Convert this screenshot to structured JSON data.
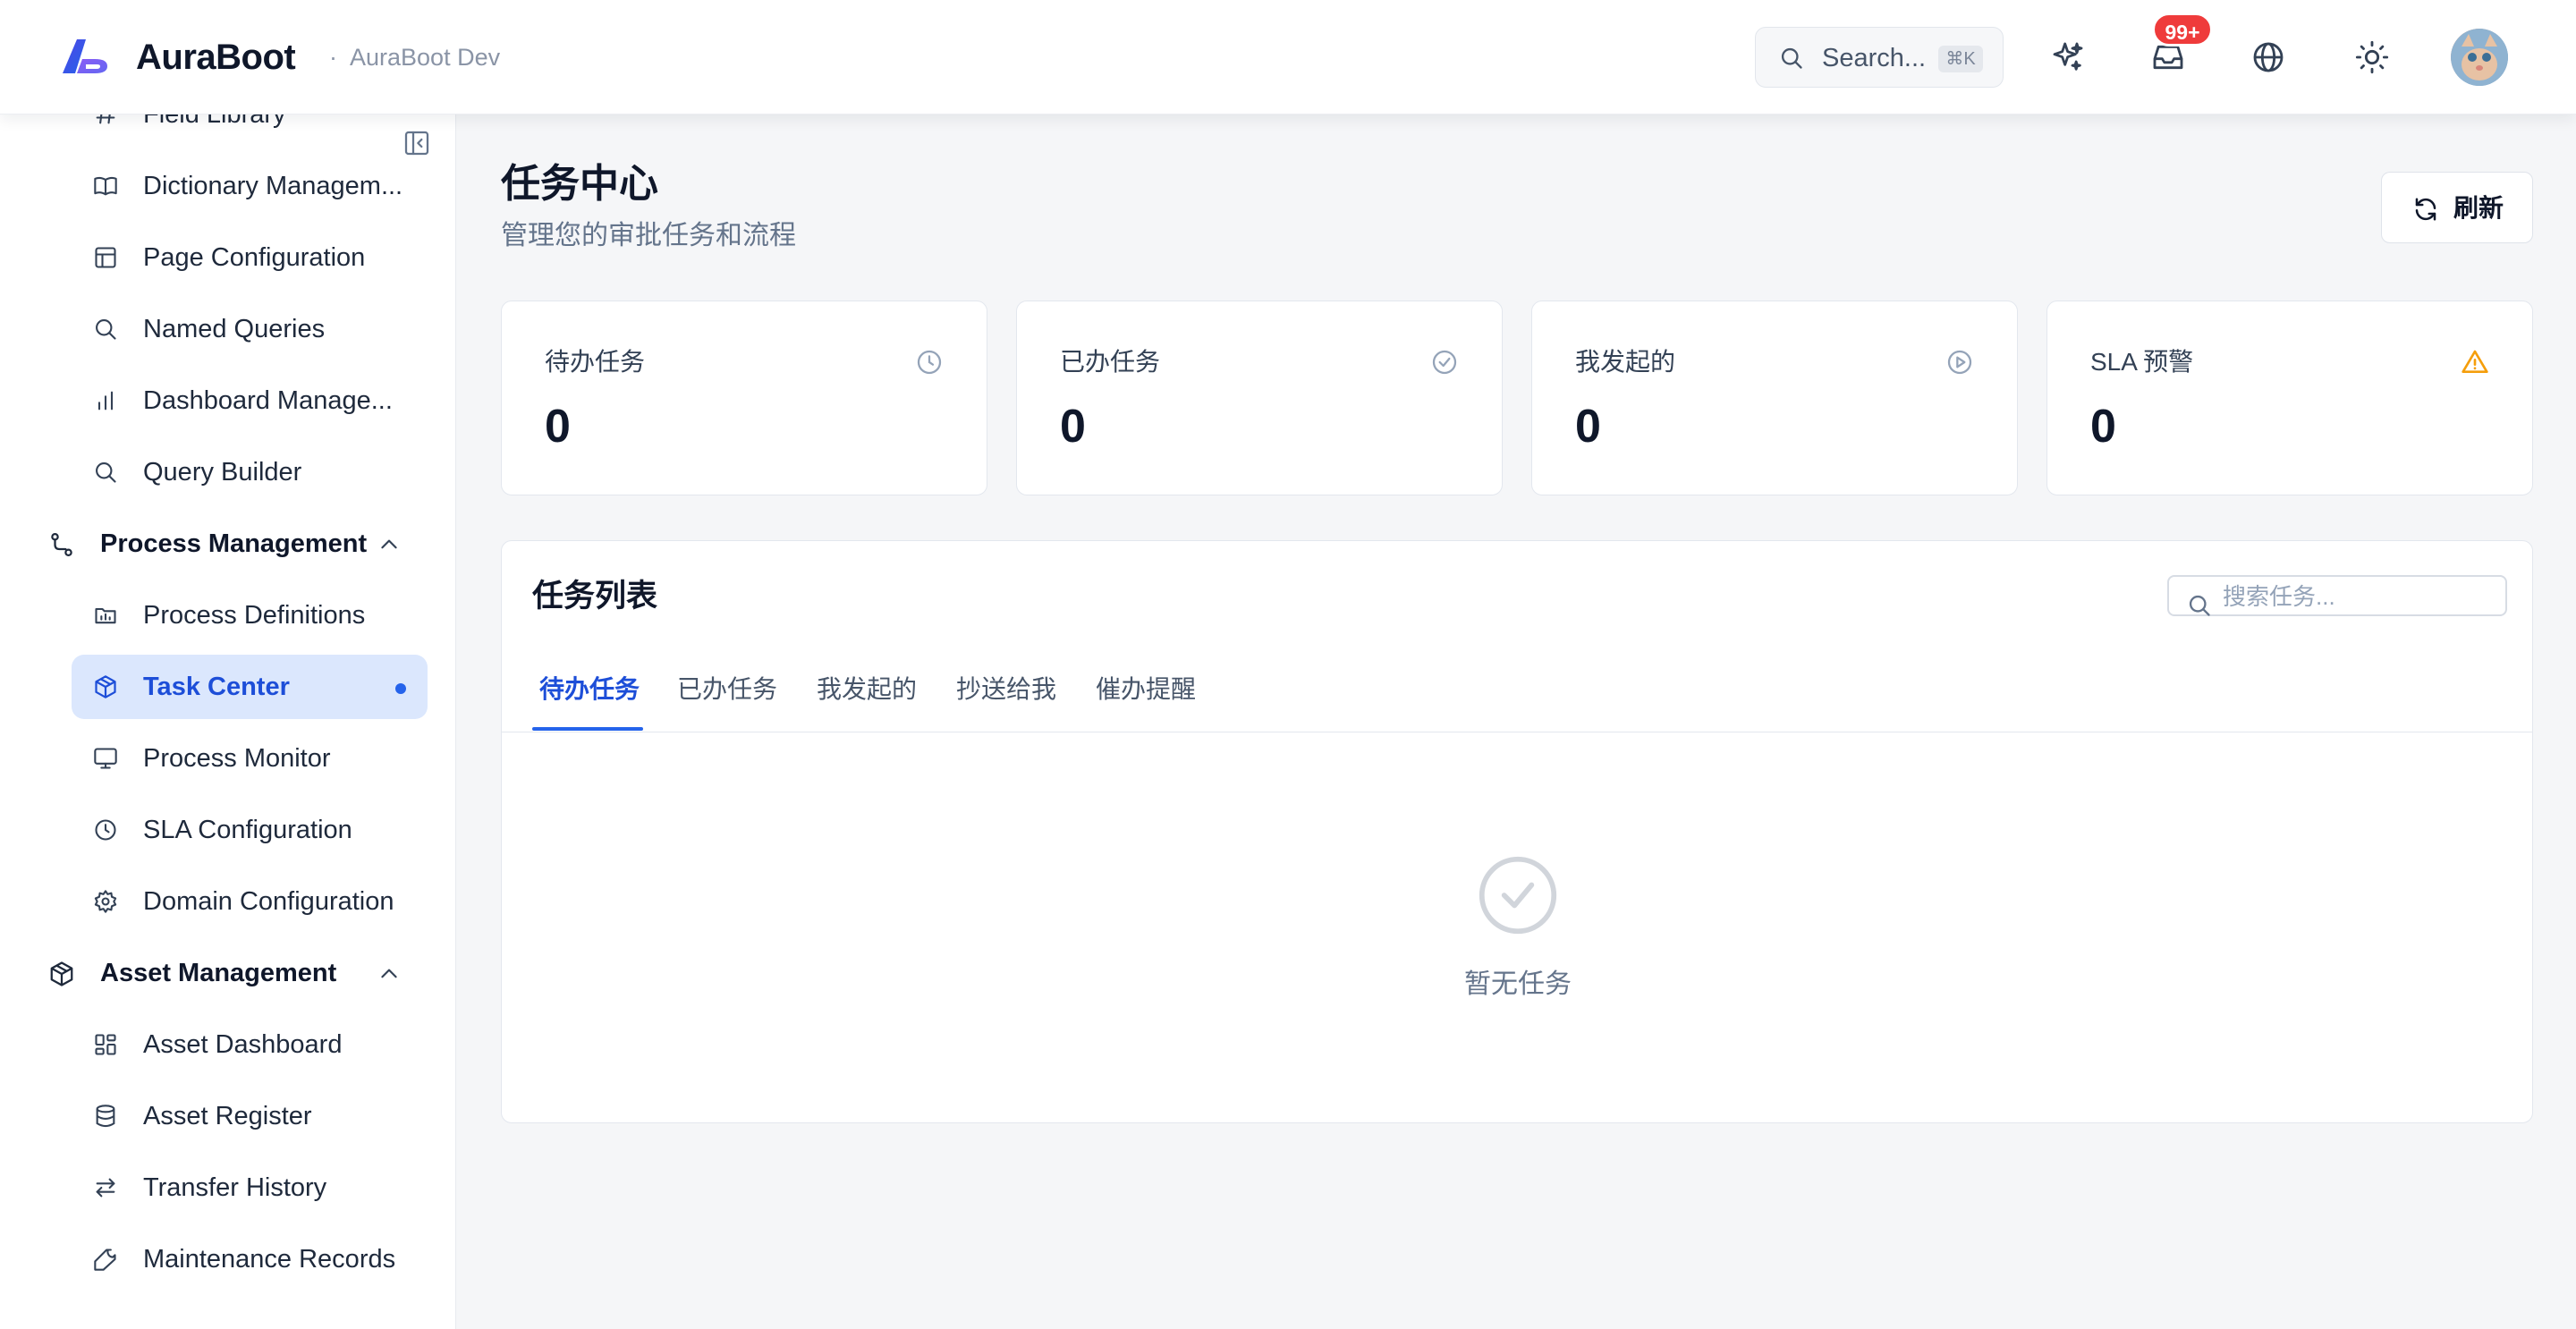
{
  "header": {
    "brand": "AuraBoot",
    "env_dot": "·",
    "env": "AuraBoot Dev",
    "search_placeholder": "Search...",
    "search_shortcut": "⌘K",
    "notification_count": "99+",
    "icons": [
      "ai-sparkle-icon",
      "inbox-icon",
      "globe-icon",
      "sun-icon"
    ]
  },
  "sidebar": {
    "items_top": [
      {
        "label": "Field Library",
        "icon": "hash-icon"
      },
      {
        "label": "Dictionary Managem...",
        "icon": "book-icon"
      },
      {
        "label": "Page Configuration",
        "icon": "layout-icon"
      },
      {
        "label": "Named Queries",
        "icon": "search-icon"
      },
      {
        "label": "Dashboard Manage...",
        "icon": "bar-chart-icon"
      },
      {
        "label": "Query Builder",
        "icon": "search-icon"
      }
    ],
    "process_group": {
      "label": "Process Management",
      "icon": "workflow-icon",
      "items": [
        {
          "label": "Process Definitions",
          "icon": "folder-chart-icon"
        },
        {
          "label": "Task Center",
          "icon": "box-icon",
          "active": true
        },
        {
          "label": "Process Monitor",
          "icon": "monitor-icon"
        },
        {
          "label": "SLA Configuration",
          "icon": "clock-icon"
        },
        {
          "label": "Domain Configuration",
          "icon": "gear-icon"
        }
      ]
    },
    "asset_group": {
      "label": "Asset Management",
      "icon": "package-icon",
      "items": [
        {
          "label": "Asset Dashboard",
          "icon": "grid-icon"
        },
        {
          "label": "Asset Register",
          "icon": "database-icon"
        },
        {
          "label": "Transfer History",
          "icon": "arrows-icon"
        },
        {
          "label": "Maintenance Records",
          "icon": "wrench-icon"
        }
      ]
    }
  },
  "page": {
    "title": "任务中心",
    "subtitle": "管理您的审批任务和流程",
    "refresh_label": "刷新"
  },
  "stats": [
    {
      "label": "待办任务",
      "value": "0",
      "icon": "clock-icon",
      "color": "#94a3b8"
    },
    {
      "label": "已办任务",
      "value": "0",
      "icon": "check-circle-icon",
      "color": "#94a3b8"
    },
    {
      "label": "我发起的",
      "value": "0",
      "icon": "play-circle-icon",
      "color": "#94a3b8"
    },
    {
      "label": "SLA 预警",
      "value": "0",
      "icon": "warning-icon",
      "color": "#f59e0b"
    }
  ],
  "task_list": {
    "title": "任务列表",
    "search_placeholder": "搜索任务...",
    "tabs": [
      "待办任务",
      "已办任务",
      "我发起的",
      "抄送给我",
      "催办提醒"
    ],
    "active_tab": 0,
    "empty_text": "暂无任务"
  },
  "colors": {
    "accent": "#2563eb",
    "active_bg": "#dbe7fd",
    "badge": "#ef3b3b",
    "warning": "#f59e0b"
  }
}
